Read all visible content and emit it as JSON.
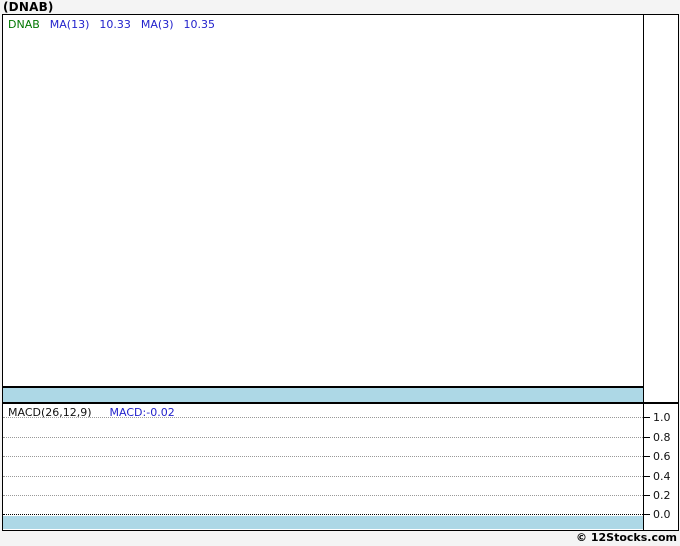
{
  "page": {
    "title": "(DNAB)",
    "copyright": "© 12Stocks.com"
  },
  "colors": {
    "page_background": "#f4f4f4",
    "panel_background": "#ffffff",
    "border": "#000000",
    "band_blue": "#add8e6",
    "grid_gray": "#999999",
    "zero_line": "#000000",
    "ticker_green": "#007700",
    "indicator_blue": "#2222cc"
  },
  "main_chart": {
    "legend": {
      "ticker": "DNAB",
      "ma13_label": "MA(13)",
      "ma13_value": "10.33",
      "ma3_label": "MA(3)",
      "ma3_value": "10.35"
    }
  },
  "macd_panel": {
    "legend_label": "MACD(26,12,9)",
    "legend_value": "MACD:-0.02",
    "axis_ticks": [
      "1.0",
      "0.8",
      "0.6",
      "0.4",
      "0.2",
      "0.0"
    ]
  },
  "chart_data": [
    {
      "type": "line",
      "title": "(DNAB) price panel",
      "series": [
        {
          "name": "DNAB",
          "visible_points": []
        },
        {
          "name": "MA(13)",
          "current_value": 10.33
        },
        {
          "name": "MA(3)",
          "current_value": 10.35
        }
      ],
      "grid": false,
      "note": "panel empty - no plotted price data visible"
    },
    {
      "type": "line",
      "title": "MACD(26,12,9)",
      "series": [
        {
          "name": "MACD",
          "current_value": -0.02,
          "visible_points": []
        }
      ],
      "y_ticks": [
        1.0,
        0.8,
        0.6,
        0.4,
        0.2,
        0.0
      ],
      "ylim_shown": [
        0.0,
        1.0
      ],
      "grid": true,
      "legend_position": "top-left",
      "note": "panel empty - no plotted MACD line visible"
    }
  ]
}
